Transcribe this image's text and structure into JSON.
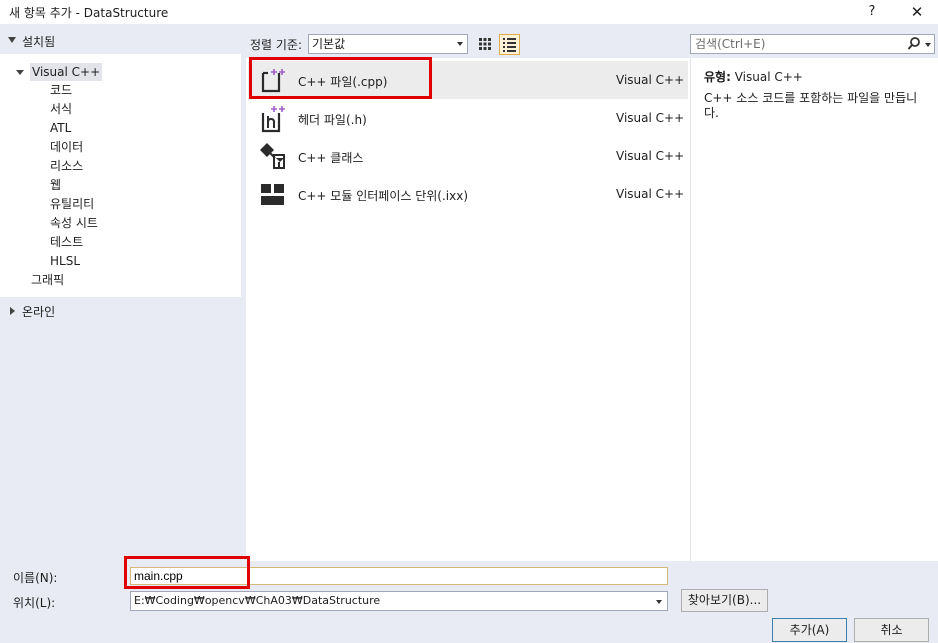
{
  "window": {
    "title": "새 항목 추가 - DataStructure",
    "help_label": "?",
    "close_label": "✕"
  },
  "left_panel": {
    "installed_label": "설치됨",
    "tree": {
      "visual_cpp": "Visual C++",
      "children": [
        "코드",
        "서식",
        "ATL",
        "데이터",
        "리소스",
        "웹",
        "유틸리티",
        "속성 시트",
        "테스트",
        "HLSL"
      ],
      "graphics": "그래픽"
    },
    "online_label": "온라인"
  },
  "toolbar": {
    "sort_label": "정렬 기준:",
    "sort_value": "기본값",
    "search_placeholder": "검색(Ctrl+E)",
    "search_icon": "search-icon"
  },
  "templates": [
    {
      "name": "C++ 파일(.cpp)",
      "lang": "Visual C++",
      "icon": "cpp-file-icon",
      "selected": true
    },
    {
      "name": "헤더 파일(.h)",
      "lang": "Visual C++",
      "icon": "header-file-icon",
      "selected": false
    },
    {
      "name": "C++ 클래스",
      "lang": "Visual C++",
      "icon": "cpp-class-icon",
      "selected": false
    },
    {
      "name": "C++ 모듈 인터페이스 단위(.ixx)",
      "lang": "Visual C++",
      "icon": "module-interface-icon",
      "selected": false
    }
  ],
  "info": {
    "type_label": "유형:",
    "type_value": "Visual C++",
    "description": "C++ 소스 코드를 포함하는 파일을 만듭니다."
  },
  "bottom": {
    "name_label": "이름(N):",
    "name_value": "main.cpp",
    "location_label": "위치(L):",
    "location_value": "E:₩Coding₩opencv₩ChA03₩DataStructure",
    "browse_label": "찾아보기(B)...",
    "add_label": "추가(A)",
    "cancel_label": "취소"
  },
  "colors": {
    "panel_bg": "#e8ebf3",
    "highlight_red": "#e00000",
    "icon_purple": "#a05ec8",
    "icon_dark": "#2b2b2b"
  }
}
